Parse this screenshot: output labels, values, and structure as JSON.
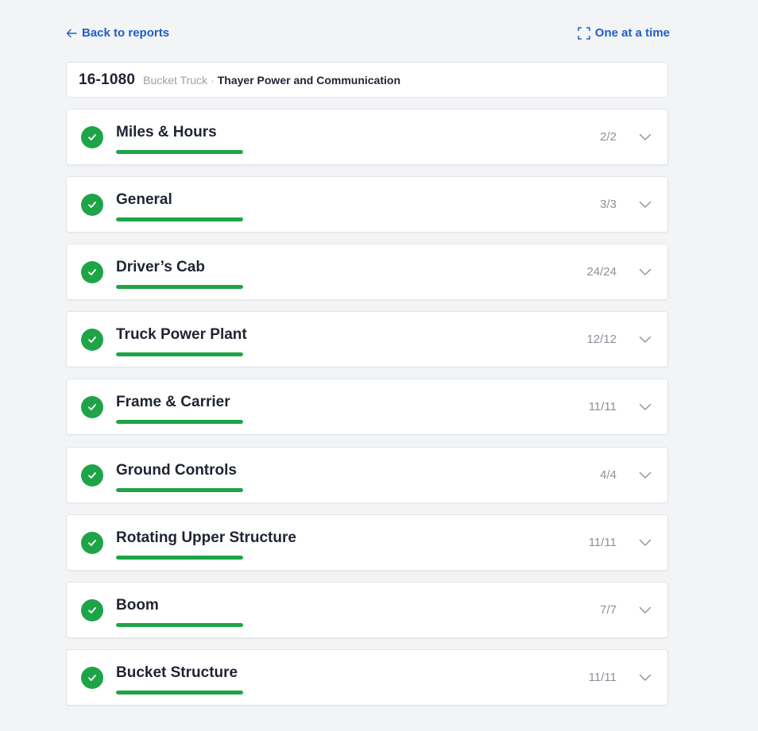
{
  "nav": {
    "back_label": "Back to reports",
    "one_at_a_time_label": "One at a time"
  },
  "vehicle": {
    "id": "16-1080",
    "type": "Bucket Truck",
    "separator": "·",
    "company": "Thayer Power and Communication"
  },
  "colors": {
    "accent": "#1f5fc4",
    "complete": "#1ea447",
    "muted": "#8b909a"
  },
  "sections": [
    {
      "title": "Miles & Hours",
      "count": "2/2",
      "progress": 1.0
    },
    {
      "title": "General",
      "count": "3/3",
      "progress": 1.0
    },
    {
      "title": "Driver’s Cab",
      "count": "24/24",
      "progress": 1.0
    },
    {
      "title": "Truck Power Plant",
      "count": "12/12",
      "progress": 1.0
    },
    {
      "title": "Frame & Carrier",
      "count": "11/11",
      "progress": 1.0
    },
    {
      "title": "Ground Controls",
      "count": "4/4",
      "progress": 1.0
    },
    {
      "title": "Rotating Upper Structure",
      "count": "11/11",
      "progress": 1.0
    },
    {
      "title": "Boom",
      "count": "7/7",
      "progress": 1.0
    },
    {
      "title": "Bucket Structure",
      "count": "11/11",
      "progress": 1.0
    }
  ],
  "icons": {
    "back": "arrow-left-icon",
    "one_at_a_time": "expand-frame-icon",
    "check": "check-circle-icon",
    "chevron": "chevron-down-icon"
  }
}
